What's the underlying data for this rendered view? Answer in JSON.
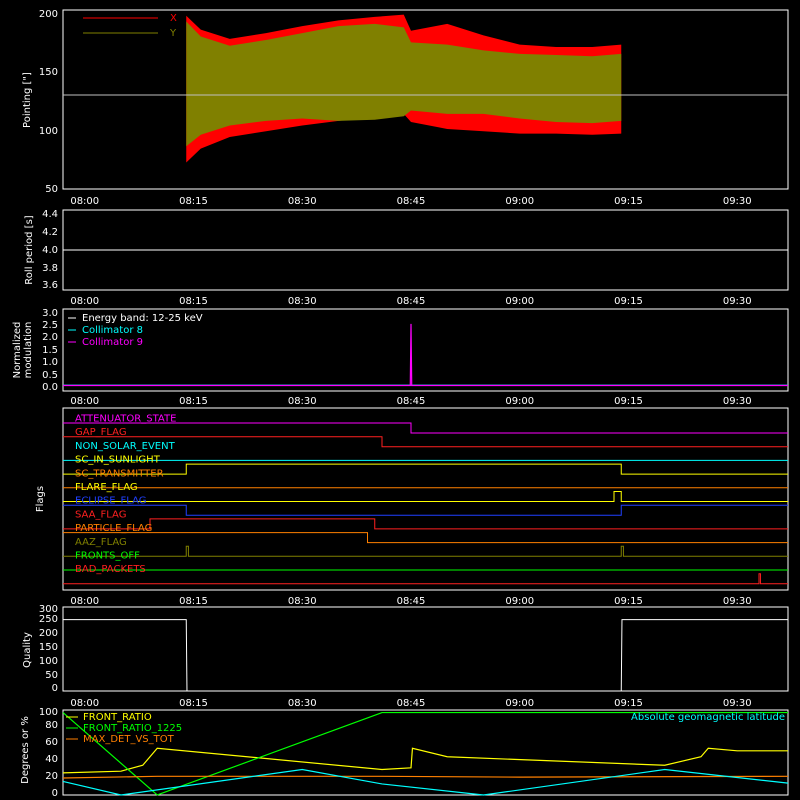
{
  "time_ticks": [
    "08:00",
    "08:15",
    "08:30",
    "08:45",
    "09:00",
    "09:15",
    "09:30"
  ],
  "panels": {
    "pointing": {
      "ylabel": "Pointing [\"]",
      "yticks": [
        "50",
        "100",
        "150",
        "200"
      ],
      "legend": [
        {
          "label": "X",
          "color": "#ff0000"
        },
        {
          "label": "Y",
          "color": "#808000"
        }
      ]
    },
    "roll": {
      "ylabel": "Roll period [s]",
      "yticks": [
        "3.6",
        "3.8",
        "4.0",
        "4.2",
        "4.4"
      ]
    },
    "modulation": {
      "ylabel_line1": "Normalized",
      "ylabel_line2": "modulation",
      "yticks": [
        "0.0",
        "0.5",
        "1.0",
        "1.5",
        "2.0",
        "2.5",
        "3.0"
      ],
      "legend": [
        {
          "label": "Energy band: 12-25 keV",
          "color": "#ffffff"
        },
        {
          "label": "Collimator 8",
          "color": "#00ffff"
        },
        {
          "label": "Collimator 9",
          "color": "#ff00ff"
        }
      ]
    },
    "flags": {
      "ylabel": "Flags",
      "items": [
        {
          "label": "ATTENUATOR_STATE",
          "color": "#ff00ff"
        },
        {
          "label": "GAP_FLAG",
          "color": "#ff2020"
        },
        {
          "label": "NON_SOLAR_EVENT",
          "color": "#00ffff"
        },
        {
          "label": "SC_IN_SUNLIGHT",
          "color": "#ffff00"
        },
        {
          "label": "SC_TRANSMITTER",
          "color": "#ff8000"
        },
        {
          "label": "FLARE_FLAG",
          "color": "#ffff00"
        },
        {
          "label": "ECLIPSE_FLAG",
          "color": "#2040ff"
        },
        {
          "label": "SAA_FLAG",
          "color": "#ff2020"
        },
        {
          "label": "PARTICLE_FLAG",
          "color": "#ff8000"
        },
        {
          "label": "AAZ_FLAG",
          "color": "#808000"
        },
        {
          "label": "FRONTS_OFF",
          "color": "#00ff00"
        },
        {
          "label": "BAD_PACKETS",
          "color": "#ff2020"
        }
      ]
    },
    "quality": {
      "ylabel": "Quality",
      "yticks": [
        "0",
        "50",
        "100",
        "150",
        "200",
        "250",
        "300"
      ]
    },
    "degrees": {
      "ylabel": "Degrees or %",
      "yticks": [
        "0",
        "20",
        "40",
        "60",
        "80",
        "100"
      ],
      "legend": [
        {
          "label": "FRONT_RATIO",
          "color": "#ffff00"
        },
        {
          "label": "FRONT_RATIO_1225",
          "color": "#00ff00"
        },
        {
          "label": "MAX_DET_VS_TOT",
          "color": "#ff8000"
        }
      ],
      "legend_right": {
        "label": "Absolute geomagnetic latitude",
        "color": "#00ffff"
      }
    }
  },
  "chart_data": [
    {
      "type": "area",
      "name": "pointing",
      "ylim": [
        45,
        200
      ],
      "x_range": [
        "07:57",
        "09:37"
      ],
      "reference_line": 129,
      "series": [
        {
          "name": "X",
          "x": [
            "08:14",
            "08:16",
            "08:20",
            "08:25",
            "08:30",
            "08:35",
            "08:40",
            "08:44",
            "08:45",
            "08:50",
            "08:55",
            "09:00",
            "09:05",
            "09:10",
            "09:14"
          ],
          "upper": [
            195,
            183,
            175,
            180,
            186,
            191,
            194,
            196,
            182,
            188,
            178,
            170,
            168,
            168,
            170
          ],
          "lower": [
            68,
            80,
            90,
            95,
            100,
            104,
            108,
            110,
            103,
            97,
            95,
            93,
            93,
            92,
            93
          ]
        },
        {
          "name": "Y",
          "x": [
            "08:14",
            "08:16",
            "08:20",
            "08:25",
            "08:30",
            "08:35",
            "08:40",
            "08:44",
            "08:45",
            "08:50",
            "08:55",
            "09:00",
            "09:05",
            "09:10",
            "09:14"
          ],
          "upper": [
            190,
            177,
            169,
            174,
            180,
            186,
            188,
            185,
            172,
            170,
            165,
            162,
            161,
            160,
            162
          ],
          "lower": [
            82,
            92,
            100,
            104,
            106,
            104,
            105,
            108,
            113,
            110,
            110,
            106,
            103,
            102,
            104
          ]
        }
      ]
    },
    {
      "type": "line",
      "name": "roll period",
      "ylim": [
        3.5,
        4.5
      ],
      "series": [
        {
          "name": "",
          "x": [
            "07:57",
            "09:37"
          ],
          "values": [
            4.0,
            4.0
          ]
        }
      ]
    },
    {
      "type": "line",
      "name": "modulation",
      "ylim": [
        -0.2,
        3.1
      ],
      "series": [
        {
          "name": "Collimator 8",
          "x": [
            "07:57",
            "08:10",
            "08:41",
            "08:45",
            "08:46",
            "09:37"
          ],
          "values": [
            0.03,
            0.03,
            0.03,
            0.03,
            0.03,
            0.03
          ]
        },
        {
          "name": "Collimator 9",
          "x": [
            "07:57",
            "08:10",
            "08:41",
            "08:44.9",
            "08:45",
            "08:45.1",
            "09:37"
          ],
          "values": [
            0.02,
            0.02,
            0.02,
            0.02,
            2.5,
            0.02,
            0.02
          ]
        }
      ]
    },
    {
      "type": "line",
      "name": "flags",
      "steps": [
        {
          "flag": "ATTENUATOR_STATE",
          "x": [
            "07:57",
            "08:45",
            "09:37"
          ],
          "values": [
            1,
            0,
            0
          ]
        },
        {
          "flag": "GAP_FLAG",
          "x": [
            "07:57",
            "08:41",
            "09:37"
          ],
          "values": [
            1,
            0,
            0
          ]
        },
        {
          "flag": "NON_SOLAR_EVENT",
          "x": [
            "07:57",
            "09:37"
          ],
          "values": [
            0,
            0
          ]
        },
        {
          "flag": "SC_IN_SUNLIGHT",
          "x": [
            "07:57",
            "08:14",
            "09:14",
            "09:37"
          ],
          "values": [
            0,
            1,
            0,
            0
          ]
        },
        {
          "flag": "SC_TRANSMITTER",
          "x": [
            "07:57",
            "09:37"
          ],
          "values": [
            0,
            0
          ]
        },
        {
          "flag": "FLARE_FLAG",
          "x": [
            "07:57",
            "09:13",
            "09:14",
            "09:37"
          ],
          "values": [
            0,
            1,
            0,
            0
          ]
        },
        {
          "flag": "ECLIPSE_FLAG",
          "x": [
            "07:57",
            "08:14",
            "09:14",
            "09:37"
          ],
          "values": [
            1,
            0,
            1,
            1
          ]
        },
        {
          "flag": "SAA_FLAG",
          "x": [
            "07:57",
            "08:09",
            "08:40",
            "09:37"
          ],
          "values": [
            0,
            1,
            0,
            0
          ]
        },
        {
          "flag": "PARTICLE_FLAG",
          "x": [
            "07:57",
            "08:39",
            "09:37"
          ],
          "values": [
            1,
            0,
            0
          ]
        },
        {
          "flag": "AAZ_FLAG",
          "x": [
            "07:57",
            "08:14",
            "08:14.3",
            "09:14",
            "09:14.3",
            "09:37"
          ],
          "values": [
            0,
            1,
            0,
            1,
            0,
            0
          ]
        },
        {
          "flag": "FRONTS_OFF",
          "x": [
            "07:57",
            "09:37"
          ],
          "values": [
            0,
            0
          ]
        },
        {
          "flag": "BAD_PACKETS",
          "x": [
            "07:57",
            "09:33",
            "09:33.2",
            "09:37"
          ],
          "values": [
            0,
            1,
            0,
            0
          ]
        }
      ]
    },
    {
      "type": "line",
      "name": "quality",
      "ylim": [
        0,
        300
      ],
      "series": [
        {
          "name": "",
          "x": [
            "07:57",
            "08:14",
            "08:14.1",
            "09:14",
            "09:14.1",
            "09:37"
          ],
          "values": [
            255,
            255,
            0,
            0,
            255,
            255
          ]
        }
      ]
    },
    {
      "type": "line",
      "name": "degrees",
      "ylim": [
        0,
        100
      ],
      "series": [
        {
          "name": "FRONT_RATIO",
          "x": [
            "07:57",
            "08:05",
            "08:08",
            "08:10",
            "08:41",
            "08:45",
            "08:45.2",
            "08:50",
            "09:05",
            "09:20",
            "09:25",
            "09:26",
            "09:30",
            "09:37"
          ],
          "values": [
            26,
            28,
            35,
            55,
            30,
            32,
            55,
            45,
            40,
            35,
            45,
            55,
            52,
            52
          ]
        },
        {
          "name": "FRONT_RATIO_1225",
          "x": [
            "07:57",
            "08:10",
            "08:41",
            "09:00",
            "09:37"
          ],
          "values": [
            97,
            0,
            97,
            97,
            97
          ]
        },
        {
          "name": "MAX_DET_VS_TOT",
          "x": [
            "07:57",
            "08:10",
            "08:41",
            "09:00",
            "09:37"
          ],
          "values": [
            20,
            22,
            22,
            21,
            22
          ]
        },
        {
          "name": "Absolute geomagnetic latitude",
          "x": [
            "07:57",
            "08:05",
            "08:30",
            "08:41",
            "08:55",
            "09:20",
            "09:37"
          ],
          "values": [
            16,
            0,
            30,
            13,
            0,
            30,
            14
          ]
        }
      ]
    }
  ]
}
